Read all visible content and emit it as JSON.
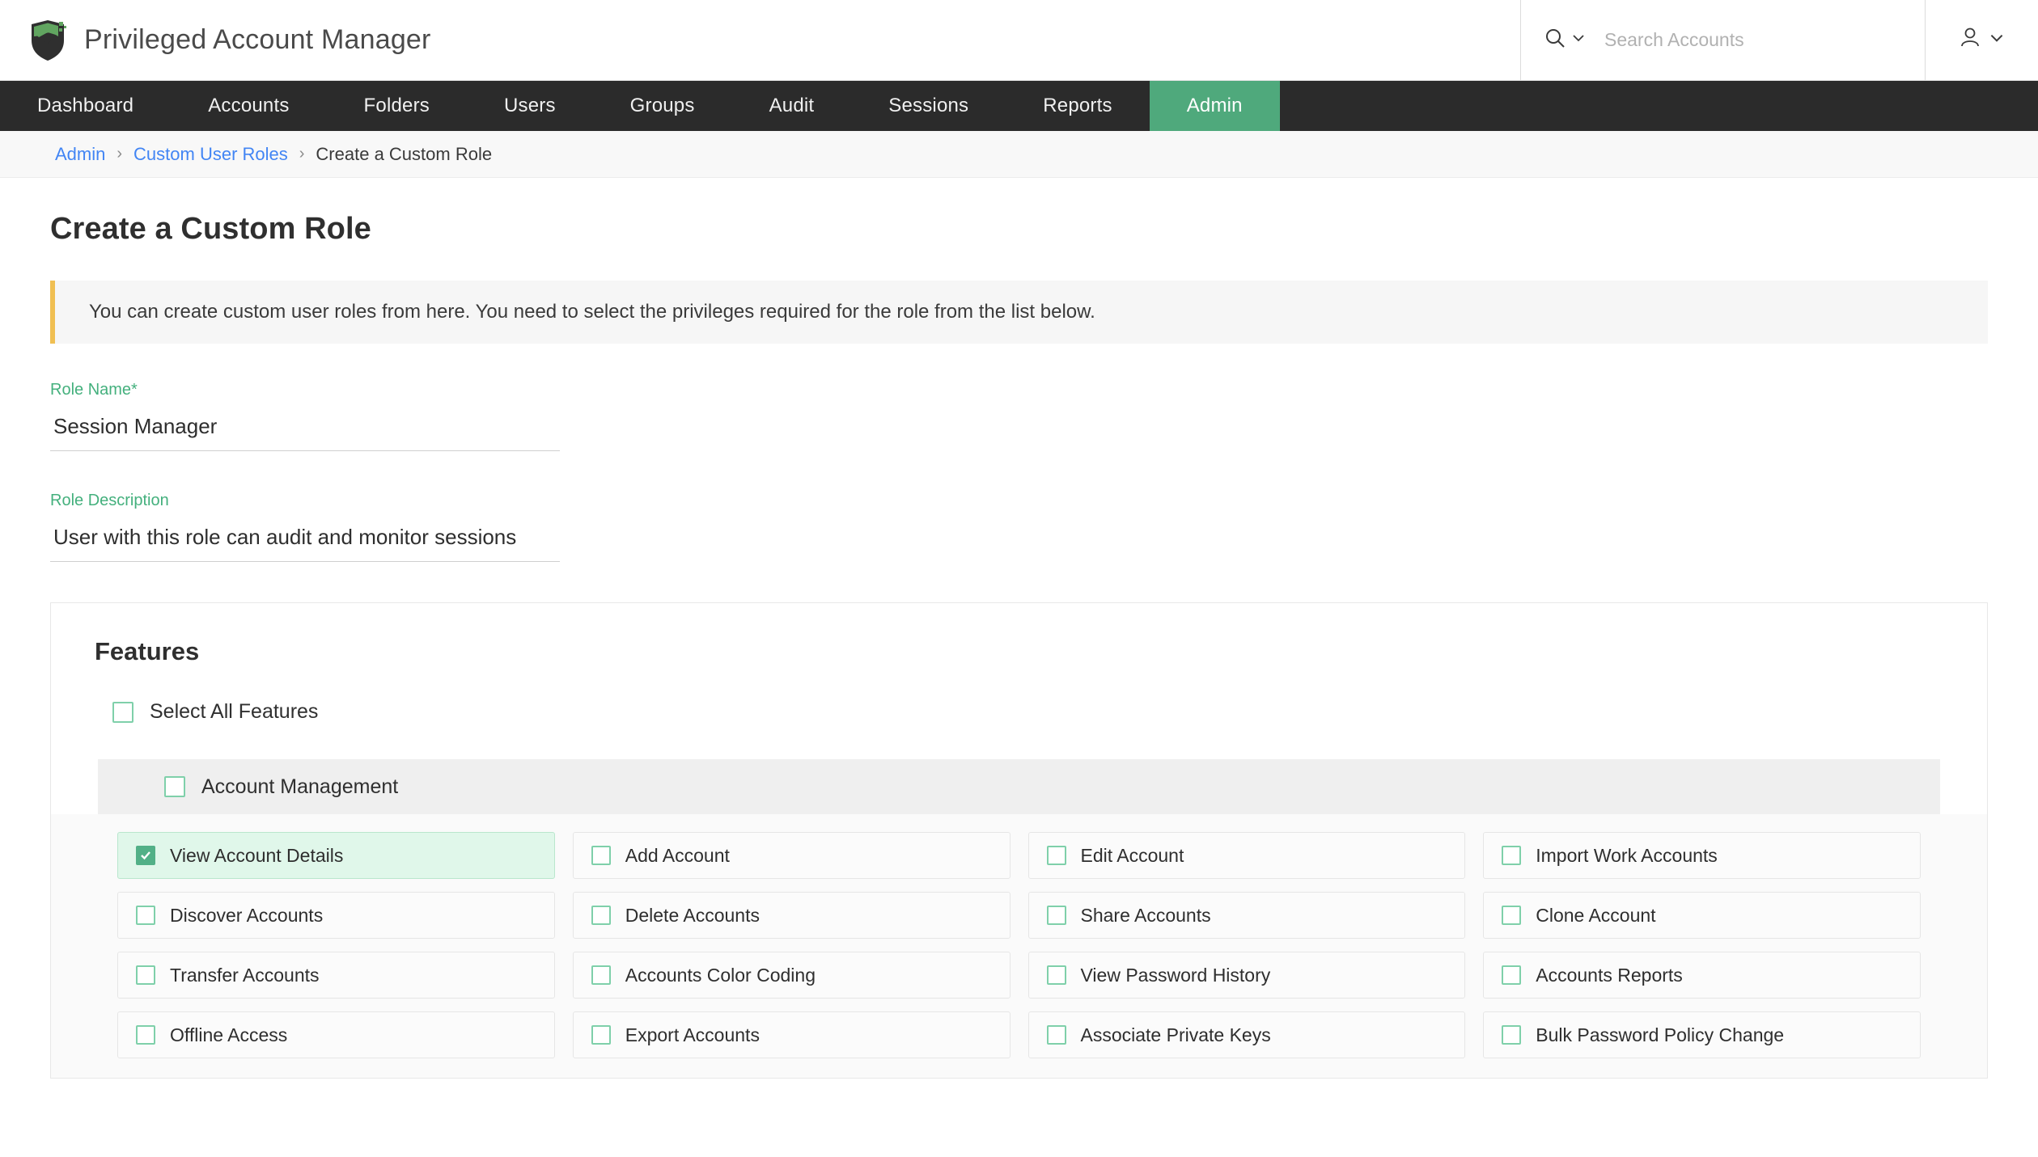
{
  "app": {
    "title": "Privileged Account Manager",
    "logo_icon": "shield-logo-icon"
  },
  "search": {
    "placeholder": "Search Accounts",
    "value": "",
    "search_icon": "search-icon",
    "dropdown_icon": "chevron-down-icon"
  },
  "user_menu": {
    "avatar_icon": "user-icon",
    "dropdown_icon": "chevron-down-icon"
  },
  "nav": {
    "items": [
      {
        "label": "Dashboard",
        "active": false
      },
      {
        "label": "Accounts",
        "active": false
      },
      {
        "label": "Folders",
        "active": false
      },
      {
        "label": "Users",
        "active": false
      },
      {
        "label": "Groups",
        "active": false
      },
      {
        "label": "Audit",
        "active": false
      },
      {
        "label": "Sessions",
        "active": false
      },
      {
        "label": "Reports",
        "active": false
      },
      {
        "label": "Admin",
        "active": true
      }
    ],
    "active_color": "#4fa97c",
    "bar_color": "#2b2b2b"
  },
  "breadcrumb": {
    "items": [
      {
        "label": "Admin",
        "link": true
      },
      {
        "label": "Custom User Roles",
        "link": true
      },
      {
        "label": "Create a Custom Role",
        "link": false
      }
    ],
    "separator": "›",
    "link_color": "#4285f4"
  },
  "page": {
    "title": "Create a Custom Role"
  },
  "info_banner": {
    "text": "You can create custom user roles from here. You need to select the privileges required for the role from the list below.",
    "accent_color": "#f0bf52"
  },
  "form": {
    "role_name": {
      "label": "Role Name*",
      "value": "Session Manager",
      "placeholder": ""
    },
    "role_description": {
      "label": "Role Description",
      "value": "User with this role can audit and monitor sessions",
      "placeholder": ""
    },
    "label_color": "#44b07d"
  },
  "features": {
    "heading": "Features",
    "select_all": {
      "label": "Select All Features",
      "checked": false
    },
    "groups": [
      {
        "name": "Account Management",
        "checked": false,
        "items": [
          {
            "label": "View Account Details",
            "checked": true
          },
          {
            "label": "Add Account",
            "checked": false
          },
          {
            "label": "Edit Account",
            "checked": false
          },
          {
            "label": "Import Work Accounts",
            "checked": false
          },
          {
            "label": "Discover Accounts",
            "checked": false
          },
          {
            "label": "Delete Accounts",
            "checked": false
          },
          {
            "label": "Share Accounts",
            "checked": false
          },
          {
            "label": "Clone Account",
            "checked": false
          },
          {
            "label": "Transfer Accounts",
            "checked": false
          },
          {
            "label": "Accounts Color Coding",
            "checked": false
          },
          {
            "label": "View Password History",
            "checked": false
          },
          {
            "label": "Accounts Reports",
            "checked": false
          },
          {
            "label": "Offline Access",
            "checked": false
          },
          {
            "label": "Export Accounts",
            "checked": false
          },
          {
            "label": "Associate Private Keys",
            "checked": false
          },
          {
            "label": "Bulk Password Policy Change",
            "checked": false
          }
        ]
      }
    ],
    "checkbox_border_color": "#7fd0aa",
    "checkbox_checked_color": "#52b087",
    "checked_cell_bg": "#e0f7ea"
  }
}
